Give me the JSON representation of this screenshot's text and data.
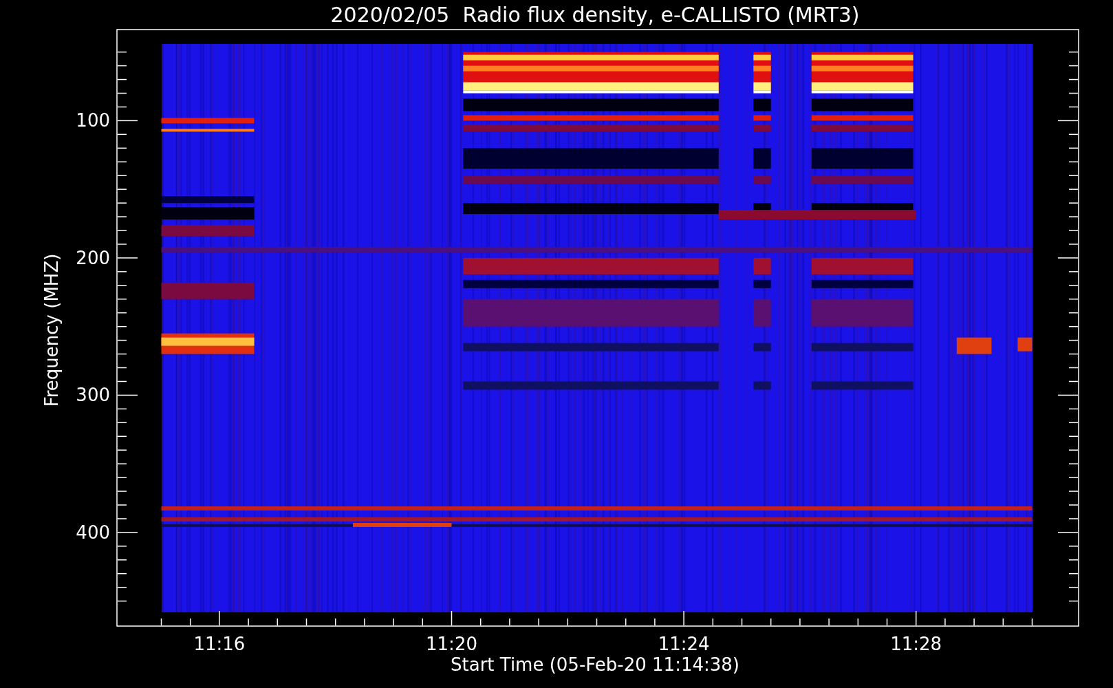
{
  "chart": {
    "title": "2020/02/05  Radio flux density, e-CALLISTO (MRT3)",
    "xlabel": "Start Time (05-Feb-20 11:14:38)",
    "ylabel": "Frequency (MHZ)",
    "xticks": [
      "11:16",
      "11:20",
      "11:24",
      "11:28"
    ],
    "yticks": [
      "100",
      "200",
      "300",
      "400"
    ]
  }
}
